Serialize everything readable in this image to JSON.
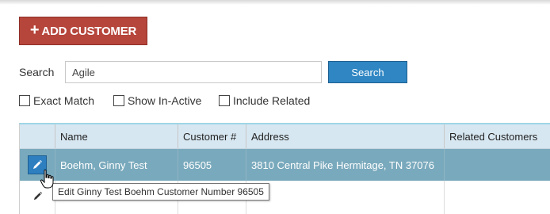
{
  "toolbar": {
    "add_customer_label": "ADD CUSTOMER",
    "add_customer_icon": "plus-icon",
    "add_customer_color": "#b6453b"
  },
  "search": {
    "label": "Search",
    "value": "Agile",
    "button_label": "Search",
    "button_color": "#2f86c3"
  },
  "filters": [
    {
      "label": "Exact Match",
      "checked": false
    },
    {
      "label": "Show In-Active",
      "checked": false
    },
    {
      "label": "Include Related",
      "checked": false
    }
  ],
  "grid": {
    "columns": [
      "",
      "Name",
      "Customer #",
      "Address",
      "Related Customers"
    ],
    "rows": [
      {
        "name": "Boehm, Ginny Test",
        "customer_number": "96505",
        "address": "3810 Central Pike Hermitage, TN 37076",
        "related": "",
        "selected": true,
        "edit_icon": "pencil-icon"
      }
    ],
    "selected_row_color": "#79a9bc",
    "header_color": "#d7e7f1"
  },
  "tooltip": {
    "text": "Edit Ginny Test Boehm Customer Number 96505"
  }
}
